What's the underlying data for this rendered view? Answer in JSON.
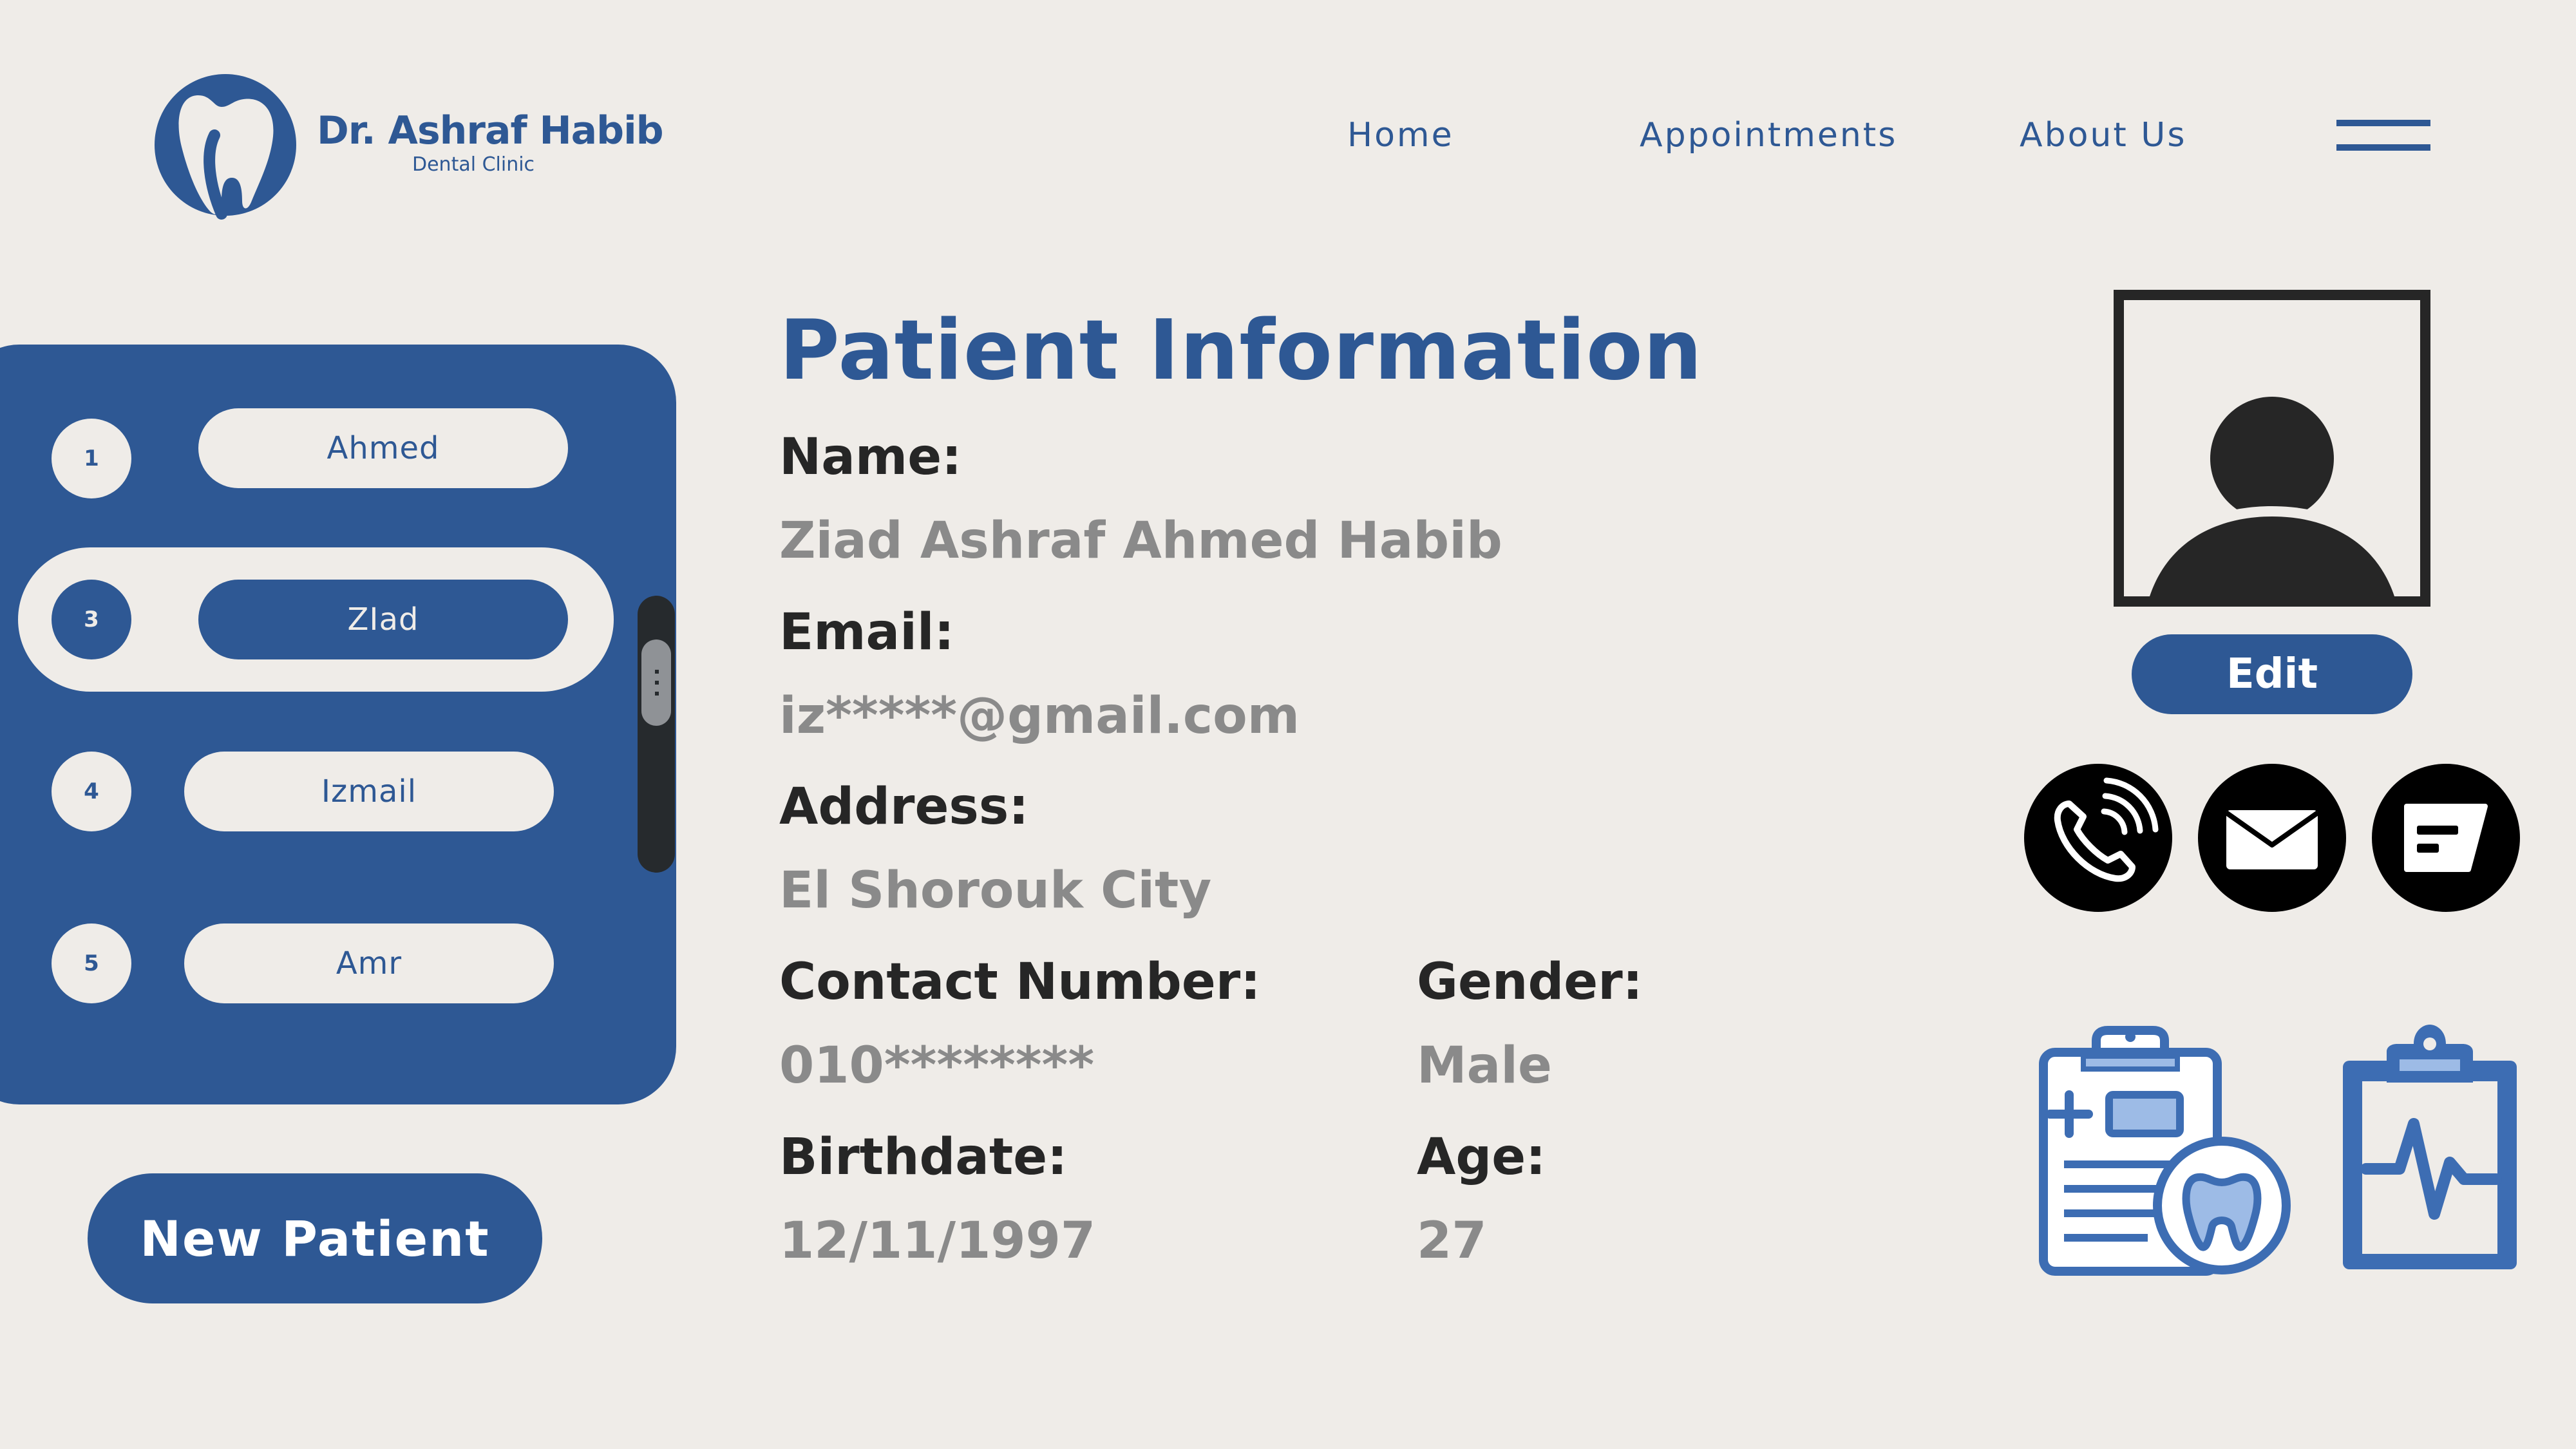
{
  "brand": {
    "name": "Dr. Ashraf Habib",
    "subtitle": "Dental Clinic"
  },
  "nav": {
    "home": "Home",
    "appointments": "Appointments",
    "about": "About Us"
  },
  "patient_list": {
    "items": [
      {
        "number": "1",
        "name": "Ahmed",
        "selected": false
      },
      {
        "number": "3",
        "name": "ZIad",
        "selected": true
      },
      {
        "number": "4",
        "name": "Izmail",
        "selected": false
      },
      {
        "number": "5",
        "name": "Amr",
        "selected": false
      }
    ],
    "new_patient_label": "New Patient"
  },
  "patient_info": {
    "title": "Patient Information",
    "name_label": "Name:",
    "name_value": "Ziad Ashraf Ahmed Habib",
    "email_label": "Email:",
    "email_value": "iz*****@gmail.com",
    "address_label": "Address:",
    "address_value": "El Shorouk City",
    "contact_label": "Contact Number:",
    "contact_value": "010********",
    "gender_label": "Gender:",
    "gender_value": "Male",
    "birthdate_label": "Birthdate:",
    "birthdate_value": "12/11/1997",
    "age_label": "Age:",
    "age_value": "27"
  },
  "actions": {
    "edit_label": "Edit",
    "icons": [
      "phone-icon",
      "mail-icon",
      "message-icon",
      "dental-record-icon",
      "medical-clipboard-icon"
    ]
  },
  "colors": {
    "brand_blue": "#2e5894",
    "background": "#efece8",
    "label_text": "#262626",
    "value_text": "#8a8a8a",
    "icon_light_blue": "#9dbbe6"
  }
}
